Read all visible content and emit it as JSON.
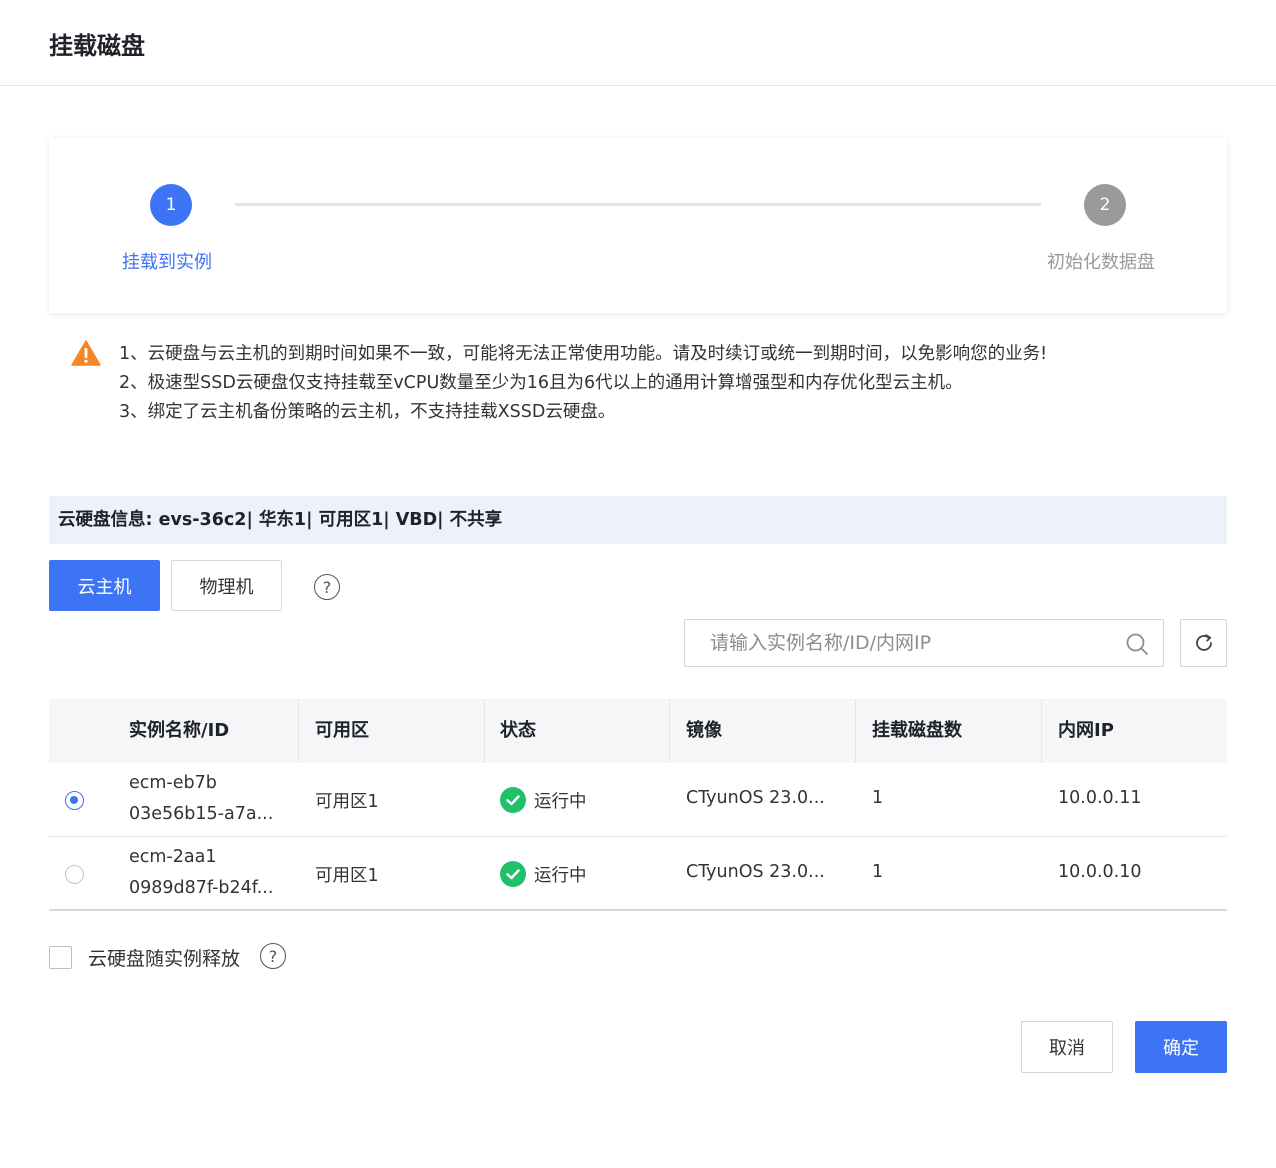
{
  "dialog": {
    "title": "挂载磁盘"
  },
  "steps": [
    {
      "number": "1",
      "label": "挂载到实例"
    },
    {
      "number": "2",
      "label": "初始化数据盘"
    }
  ],
  "warnings": [
    "1、云硬盘与云主机的到期时间如果不一致，可能将无法正常使用功能。请及时续订或统一到期时间，以免影响您的业务!",
    "2、极速型SSD云硬盘仅支持挂载至vCPU数量至少为16且为6代以上的通用计算增强型和内存优化型云主机。",
    "3、绑定了云主机备份策略的云主机，不支持挂载XSSD云硬盘。"
  ],
  "disk_info": "云硬盘信息: evs-36c2| 华东1| 可用区1| VBD| 不共享",
  "tabs": {
    "vm": "云主机",
    "pm": "物理机",
    "help": "?"
  },
  "search": {
    "placeholder": "请输入实例名称/ID/内网IP"
  },
  "table": {
    "headers": [
      "实例名称/ID",
      "可用区",
      "状态",
      "镜像",
      "挂载磁盘数",
      "内网IP"
    ],
    "rows": [
      {
        "name": "ecm-eb7b",
        "id": "03e56b15-a7a...",
        "zone": "可用区1",
        "status": "运行中",
        "image": "CTyunOS 23.0...",
        "disks": "1",
        "ip": "10.0.0.11",
        "selected": true
      },
      {
        "name": "ecm-2aa1",
        "id": "0989d87f-b24f...",
        "zone": "可用区1",
        "status": "运行中",
        "image": "CTyunOS 23.0...",
        "disks": "1",
        "ip": "10.0.0.10",
        "selected": false
      }
    ]
  },
  "release_option": {
    "label": "云硬盘随实例释放",
    "checked": false,
    "help": "?"
  },
  "footer": {
    "cancel": "取消",
    "ok": "确定"
  },
  "colors": {
    "primary": "#3d73f5",
    "success": "#1fc26a",
    "warning": "#f5862a",
    "inactive": "#9a9a9a"
  }
}
